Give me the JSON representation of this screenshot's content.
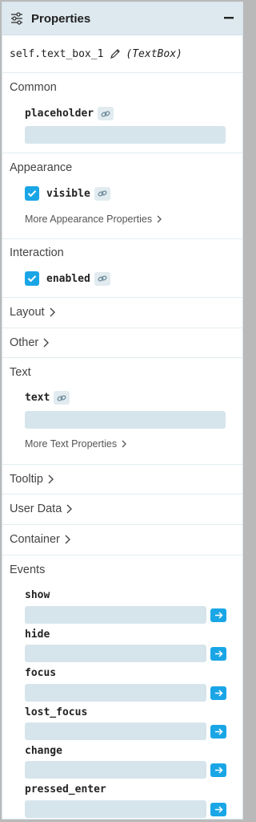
{
  "header": {
    "title": "Properties",
    "icon": "sliders-icon",
    "collapse_icon": "minus-icon"
  },
  "component": {
    "name": "self.text_box_1",
    "type": "(TextBox)"
  },
  "sections": {
    "common": {
      "title": "Common",
      "placeholder_label": "placeholder",
      "placeholder_value": ""
    },
    "appearance": {
      "title": "Appearance",
      "visible_label": "visible",
      "visible_checked": true,
      "more_label": "More Appearance Properties"
    },
    "interaction": {
      "title": "Interaction",
      "enabled_label": "enabled",
      "enabled_checked": true
    },
    "layout": {
      "title": "Layout"
    },
    "other": {
      "title": "Other"
    },
    "text": {
      "title": "Text",
      "text_label": "text",
      "text_value": "",
      "more_label": "More Text Properties"
    },
    "tooltip": {
      "title": "Tooltip"
    },
    "user_data": {
      "title": "User Data"
    },
    "container": {
      "title": "Container"
    },
    "events": {
      "title": "Events",
      "items": [
        {
          "name": "show",
          "value": ""
        },
        {
          "name": "hide",
          "value": ""
        },
        {
          "name": "focus",
          "value": ""
        },
        {
          "name": "lost_focus",
          "value": ""
        },
        {
          "name": "change",
          "value": ""
        },
        {
          "name": "pressed_enter",
          "value": ""
        }
      ]
    }
  },
  "colors": {
    "accent": "#1aa6e6",
    "header_bg": "#dde9ef",
    "field_bg": "#d6e5eb"
  }
}
